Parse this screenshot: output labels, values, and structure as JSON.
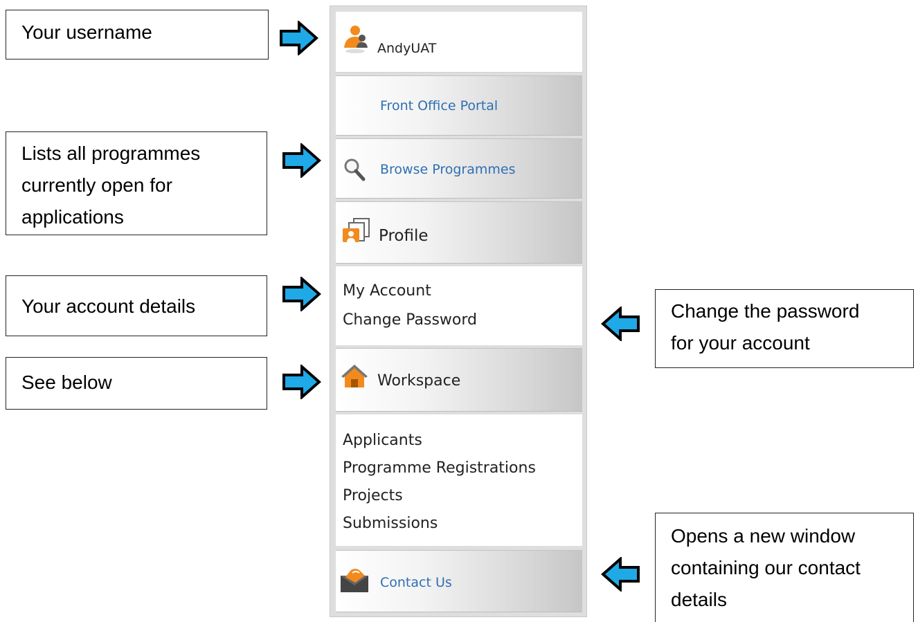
{
  "callouts": {
    "username": [
      "Your username"
    ],
    "browse": [
      "Lists all programmes",
      "currently open for",
      "applications"
    ],
    "account": [
      "Your account details"
    ],
    "workspace": [
      "See below"
    ],
    "password": [
      "Change the password",
      "for your account"
    ],
    "contact": [
      "Opens a new window",
      "containing our contact",
      "details"
    ]
  },
  "sidebar": {
    "user": {
      "name": "AndyUAT",
      "icon": "user-icon"
    },
    "portal": {
      "label": "Front Office Portal"
    },
    "browse": {
      "label": "Browse Programmes",
      "icon": "magnifier-icon"
    },
    "profile": {
      "label": "Profile",
      "icon": "profile-cards-icon"
    },
    "profile_links": [
      "My Account",
      "Change Password"
    ],
    "workspace": {
      "label": "Workspace",
      "icon": "home-icon"
    },
    "workspace_links": [
      "Applicants",
      "Programme Registrations",
      "Projects",
      "Submissions"
    ],
    "contact": {
      "label": "Contact Us",
      "icon": "envelope-icon"
    }
  },
  "colors": {
    "arrow_fill": "#1fa9e6",
    "link": "#2e6fb3",
    "icon_orange": "#f28a1e"
  }
}
